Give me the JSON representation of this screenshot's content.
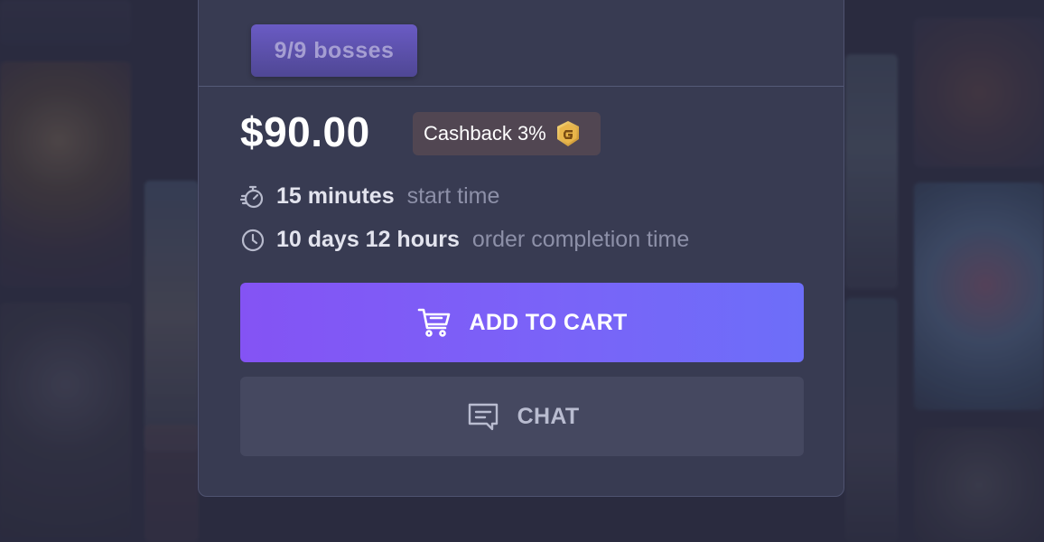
{
  "offer": {
    "boss_badge": "9/9 bosses",
    "price": "$90.00",
    "cashback_label": "Cashback 3%",
    "cashback_icon": "g-coin-icon",
    "start_time_value": "15 minutes",
    "start_time_label": "start time",
    "start_time_icon": "stopwatch-icon",
    "completion_value": "10 days 12 hours",
    "completion_label": "order completion time",
    "completion_icon": "clock-icon"
  },
  "actions": {
    "add_to_cart_label": "ADD TO CART",
    "add_to_cart_icon": "cart-icon",
    "chat_label": "CHAT",
    "chat_icon": "chat-bubble-icon"
  },
  "colors": {
    "page_bg": "#2a2c40",
    "card_bg": "#383b52",
    "accent_gradient_start": "#8453f4",
    "accent_gradient_end": "#6d6ef9",
    "cashback_bg": "#514652",
    "chat_button_bg": "#454860",
    "coin_gold": "#e8b84a"
  }
}
